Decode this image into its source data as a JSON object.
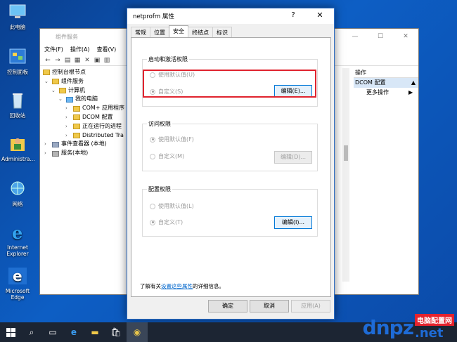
{
  "desktop": {
    "icons": [
      {
        "label": "此电脑",
        "icon": "computer-icon"
      },
      {
        "label": "控制面板",
        "icon": "control-panel-icon"
      },
      {
        "label": "回收站",
        "icon": "recycle-bin-icon"
      },
      {
        "label": "Administra...",
        "icon": "user-folder-icon"
      },
      {
        "label": "网络",
        "icon": "network-icon"
      },
      {
        "label": "Internet Explorer",
        "icon": "ie-icon"
      },
      {
        "label": "Microsoft Edge",
        "icon": "edge-icon"
      }
    ]
  },
  "mmc": {
    "title": "组件服务",
    "menu": [
      "文件(F)",
      "操作(A)",
      "查看(V)"
    ],
    "tree": [
      {
        "label": "控制台根节点",
        "level": 0
      },
      {
        "label": "组件服务",
        "level": 1
      },
      {
        "label": "计算机",
        "level": 2
      },
      {
        "label": "我的电脑",
        "level": 3
      },
      {
        "label": "COM+ 应用程序",
        "level": 4
      },
      {
        "label": "DCOM 配置",
        "level": 4
      },
      {
        "label": "正在运行的进程",
        "level": 4
      },
      {
        "label": "Distributed Tra",
        "level": 4
      },
      {
        "label": "事件查看器 (本地)",
        "level": 1
      },
      {
        "label": "服务(本地)",
        "level": 1
      }
    ],
    "actions": {
      "header": "操作",
      "selected": "DCOM 配置",
      "more": "更多操作"
    }
  },
  "dialog": {
    "title": "netprofm 属性",
    "help": "?",
    "tabs": [
      "常规",
      "位置",
      "安全",
      "终结点",
      "标识"
    ],
    "active_tab": "安全",
    "groups": {
      "launch": {
        "legend": "启动和激活权限",
        "opt_default": "使用默认值(U)",
        "opt_custom": "自定义(S)",
        "edit": "编辑(E)..."
      },
      "access": {
        "legend": "访问权限",
        "opt_default": "使用默认值(F)",
        "opt_custom": "自定义(M)",
        "edit": "编辑(D)..."
      },
      "config": {
        "legend": "配置权限",
        "opt_default": "使用默认值(L)",
        "opt_custom": "自定义(T)",
        "edit": "编辑(I)..."
      }
    },
    "learn_prefix": "了解有关",
    "learn_link": "设置这些属性",
    "learn_suffix": "的详细信息。",
    "ok": "确定",
    "cancel": "取消",
    "apply": "应用(A)"
  },
  "watermark": {
    "logo": "dnpz",
    "cn": "电脑配置网",
    "net": ".net"
  },
  "colors": {
    "highlight_box": "#e0232e",
    "accent": "#0078d7",
    "desktop": "#0d5ec4"
  }
}
